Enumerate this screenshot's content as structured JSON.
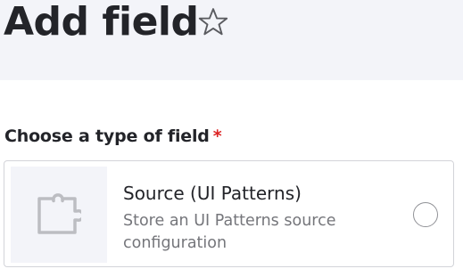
{
  "header": {
    "title": "Add field",
    "favorite_icon": "star-outline-icon"
  },
  "field": {
    "label": "Choose a type of field",
    "required_marker": "*"
  },
  "options": [
    {
      "icon": "puzzle-icon",
      "title": "Source (UI Patterns)",
      "description": "Store an UI Patterns source configuration",
      "selected": false
    }
  ],
  "colors": {
    "header_bg": "#f3f4f9",
    "text": "#232429",
    "muted_text": "#75767b",
    "required": "#dc2323",
    "border": "#d3d4d9"
  }
}
